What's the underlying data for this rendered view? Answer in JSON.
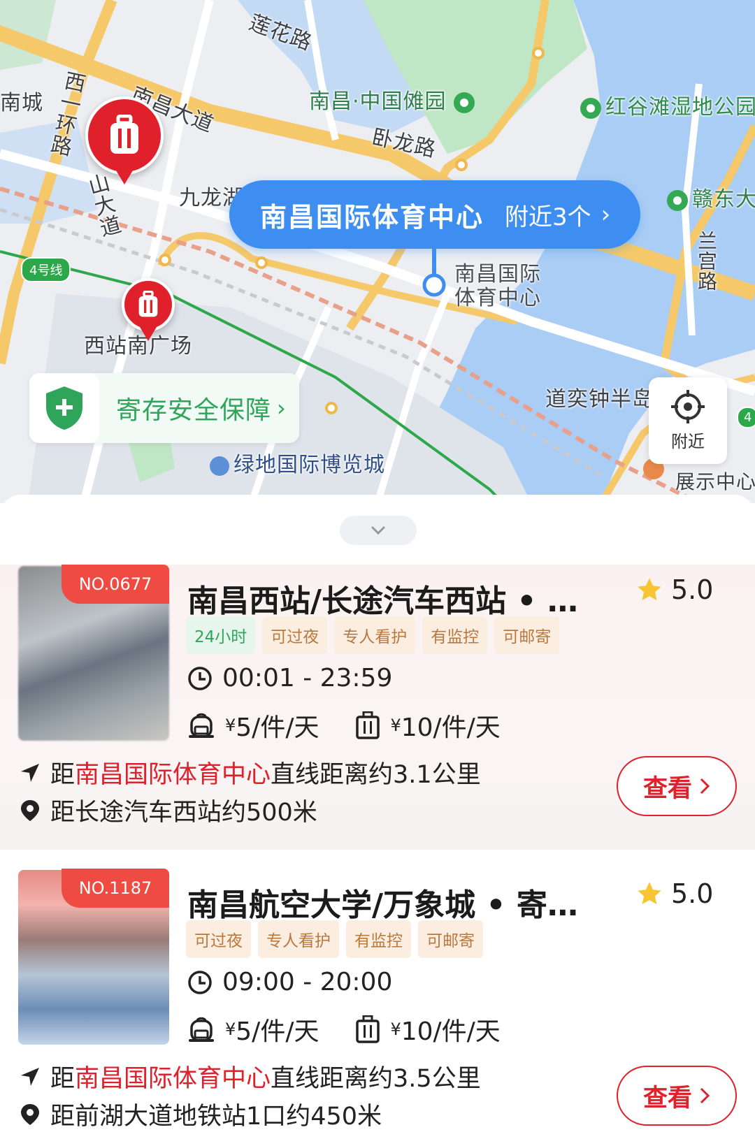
{
  "map": {
    "labels": {
      "lianhua_road": "莲花路",
      "nanchang_blvd": "南昌大道",
      "nan_cheng": "南城",
      "xi_yi_huan": "西一环路",
      "shan_dadao": "山大道",
      "nuoyuan": "南昌·中国傩园",
      "wolong_road": "卧龙路",
      "honggutan": "红谷滩湿地公园",
      "jiulong_lake": "九龙湖",
      "gandong": "赣东大",
      "langong_road": "兰宫路",
      "stadium": "南昌国际体育中心",
      "xizhan_south": "西站南广场",
      "metro_line": "4号线",
      "daoyi": "道奕钟半岛",
      "lvdi_expo": "绿地国际博览城",
      "exhibition": "展示中心",
      "metro_line_right": "4"
    },
    "bubble": {
      "title": "南昌国际体育中心",
      "nearby": "附近3个",
      "arrow": "›"
    },
    "safety": {
      "text": "寄存安全保障",
      "arrow": "›"
    },
    "nearby_button": "附近",
    "colors": {
      "water": "#a9cdf5",
      "park": "#bfe6c5",
      "road_yellow": "#f5c86a",
      "accent_blue": "#3d8ef0",
      "pin_red": "#e0202a"
    }
  },
  "listings": [
    {
      "badge": "NO.0677",
      "title": "南昌西站/长途汽车西站 • …",
      "rating": "5.0",
      "tags": [
        "24小时",
        "可过夜",
        "专人看护",
        "有监控",
        "可邮寄"
      ],
      "hours": "00:01 - 23:59",
      "price_small_yen": "¥",
      "price_small": "5/件/天",
      "price_large_yen": "¥",
      "price_large": "10/件/天",
      "dist_prefix": "距",
      "dist_target": "南昌国际体育中心",
      "dist_suffix": "直线距离约3.1公里",
      "landmark": "距长途汽车西站约500米",
      "view_label": "查看"
    },
    {
      "badge": "NO.1187",
      "title": "南昌航空大学/万象城 • 寄…",
      "rating": "5.0",
      "tags": [
        "可过夜",
        "专人看护",
        "有监控",
        "可邮寄"
      ],
      "hours": "09:00 - 20:00",
      "price_small_yen": "¥",
      "price_small": "5/件/天",
      "price_large_yen": "¥",
      "price_large": "10/件/天",
      "dist_prefix": "距",
      "dist_target": "南昌国际体育中心",
      "dist_suffix": "直线距离约3.5公里",
      "landmark": "距前湖大道地铁站1口约450米",
      "view_label": "查看"
    }
  ],
  "icons": [
    "suitcase-icon",
    "shield-plus-icon",
    "locate-icon",
    "star-icon",
    "clock-icon",
    "backpack-icon",
    "luggage-icon",
    "navigation-arrow-icon",
    "location-pin-icon",
    "chevron-down-icon",
    "chevron-right-icon"
  ]
}
